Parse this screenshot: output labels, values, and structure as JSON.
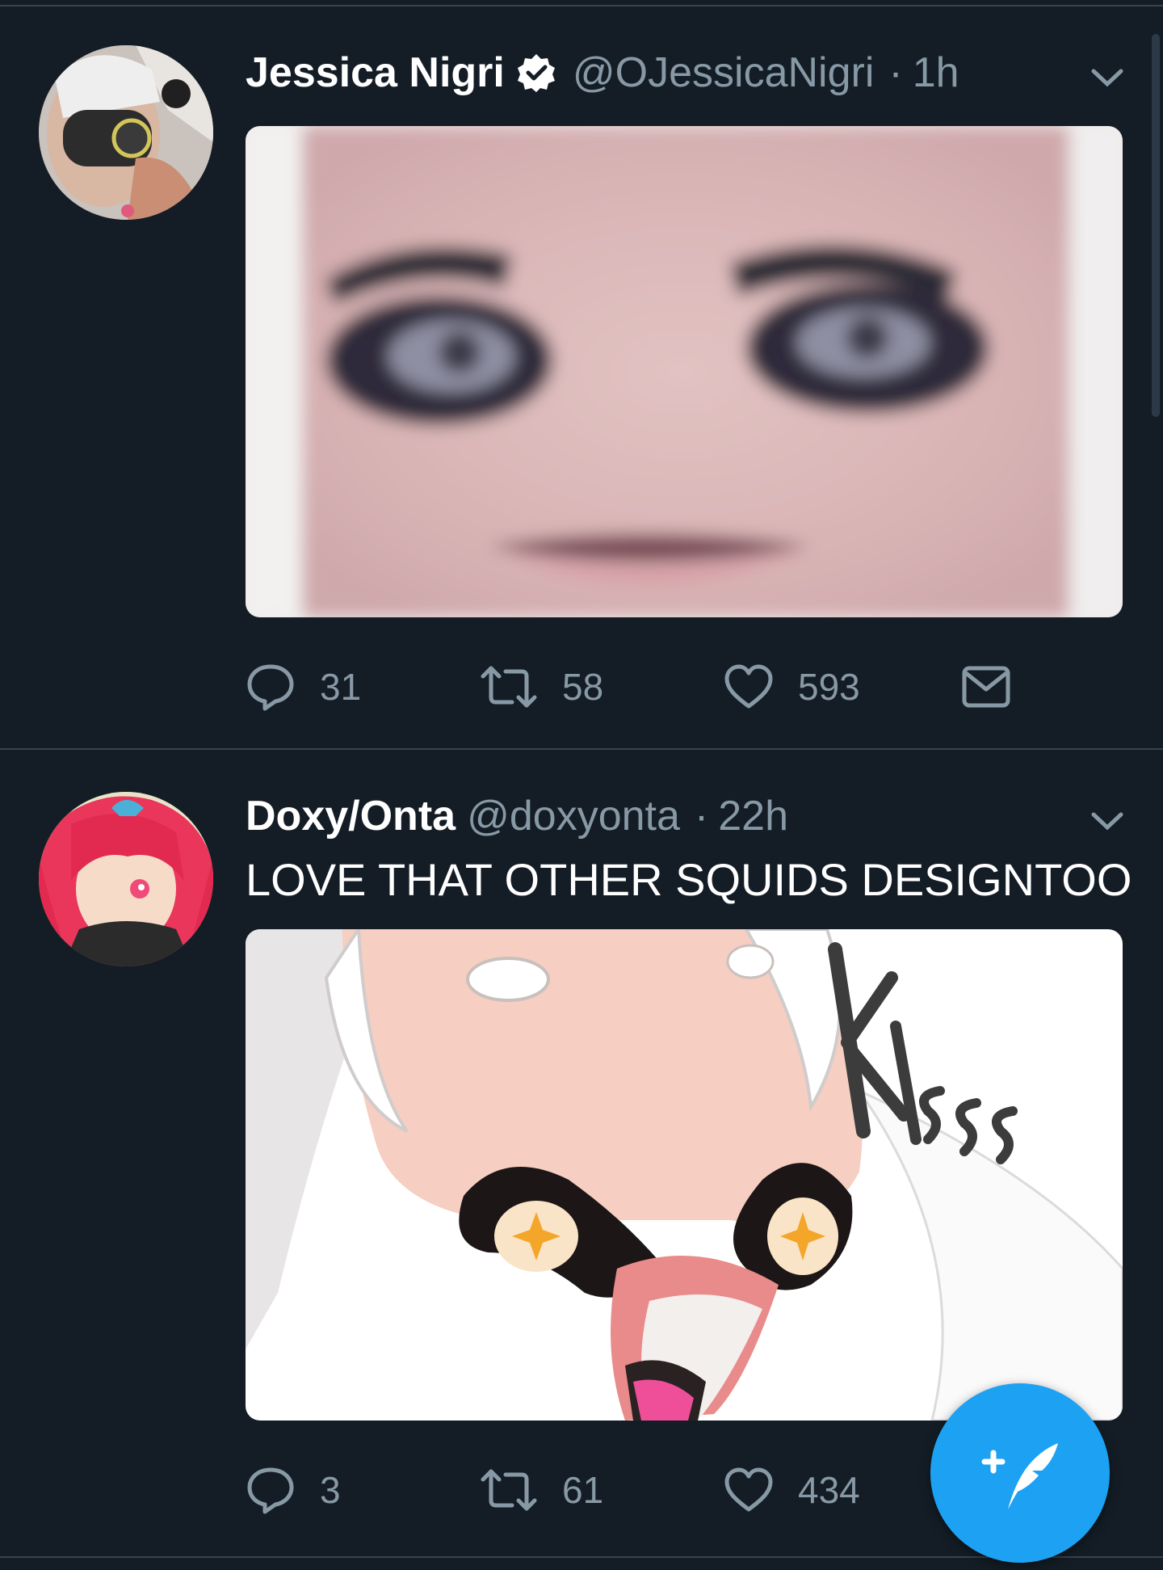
{
  "colors": {
    "background": "#141d26",
    "divider": "#38444d",
    "primary_text": "#ffffff",
    "secondary_text": "#8899a6",
    "accent": "#1da1f2"
  },
  "tweets": [
    {
      "display_name": "Jessica Nigri",
      "verified": true,
      "handle": "@OJessicaNigri",
      "separator": "·",
      "time": "1h",
      "text": "",
      "media_icon": "photo",
      "actions": {
        "reply_icon": "reply-icon",
        "reply_count": "31",
        "retweet_icon": "retweet-icon",
        "retweet_count": "58",
        "like_icon": "heart-icon",
        "like_count": "593",
        "dm_icon": "envelope-icon"
      }
    },
    {
      "display_name": "Doxy/Onta",
      "verified": false,
      "handle": "@doxyonta",
      "separator": "·",
      "time": "22h",
      "text": "LOVE THAT OTHER SQUIDS DESIGNTOO",
      "media_icon": "illustration",
      "media_caption": "Kisss",
      "actions": {
        "reply_icon": "reply-icon",
        "reply_count": "3",
        "retweet_icon": "retweet-icon",
        "retweet_count": "61",
        "like_icon": "heart-icon",
        "like_count": "434"
      }
    }
  ],
  "compose_button": {
    "icon": "compose-tweet-icon"
  }
}
